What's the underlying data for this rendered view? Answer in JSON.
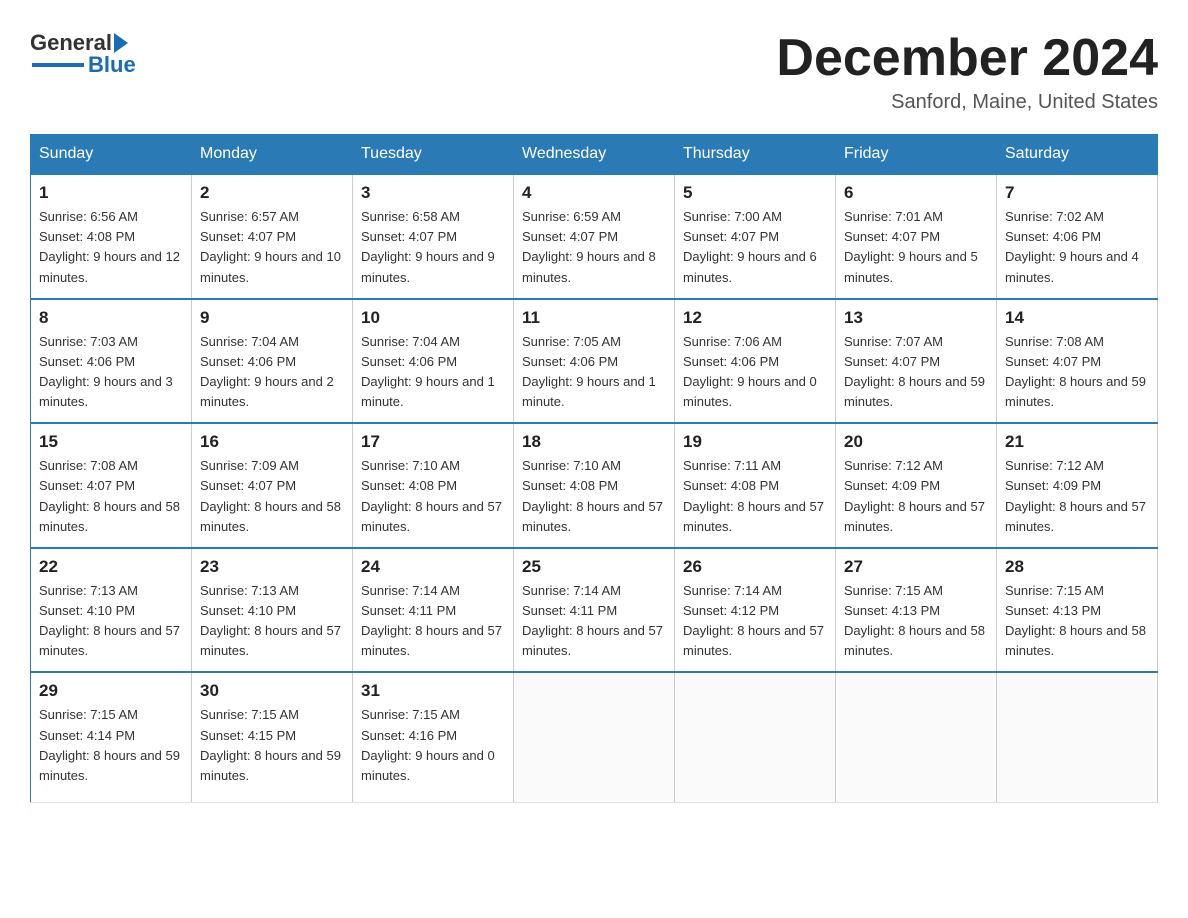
{
  "header": {
    "logo_general": "General",
    "logo_blue": "Blue",
    "month_title": "December 2024",
    "location": "Sanford, Maine, United States"
  },
  "days_of_week": [
    "Sunday",
    "Monday",
    "Tuesday",
    "Wednesday",
    "Thursday",
    "Friday",
    "Saturday"
  ],
  "weeks": [
    [
      {
        "day": 1,
        "sunrise": "Sunrise: 6:56 AM",
        "sunset": "Sunset: 4:08 PM",
        "daylight": "Daylight: 9 hours and 12 minutes."
      },
      {
        "day": 2,
        "sunrise": "Sunrise: 6:57 AM",
        "sunset": "Sunset: 4:07 PM",
        "daylight": "Daylight: 9 hours and 10 minutes."
      },
      {
        "day": 3,
        "sunrise": "Sunrise: 6:58 AM",
        "sunset": "Sunset: 4:07 PM",
        "daylight": "Daylight: 9 hours and 9 minutes."
      },
      {
        "day": 4,
        "sunrise": "Sunrise: 6:59 AM",
        "sunset": "Sunset: 4:07 PM",
        "daylight": "Daylight: 9 hours and 8 minutes."
      },
      {
        "day": 5,
        "sunrise": "Sunrise: 7:00 AM",
        "sunset": "Sunset: 4:07 PM",
        "daylight": "Daylight: 9 hours and 6 minutes."
      },
      {
        "day": 6,
        "sunrise": "Sunrise: 7:01 AM",
        "sunset": "Sunset: 4:07 PM",
        "daylight": "Daylight: 9 hours and 5 minutes."
      },
      {
        "day": 7,
        "sunrise": "Sunrise: 7:02 AM",
        "sunset": "Sunset: 4:06 PM",
        "daylight": "Daylight: 9 hours and 4 minutes."
      }
    ],
    [
      {
        "day": 8,
        "sunrise": "Sunrise: 7:03 AM",
        "sunset": "Sunset: 4:06 PM",
        "daylight": "Daylight: 9 hours and 3 minutes."
      },
      {
        "day": 9,
        "sunrise": "Sunrise: 7:04 AM",
        "sunset": "Sunset: 4:06 PM",
        "daylight": "Daylight: 9 hours and 2 minutes."
      },
      {
        "day": 10,
        "sunrise": "Sunrise: 7:04 AM",
        "sunset": "Sunset: 4:06 PM",
        "daylight": "Daylight: 9 hours and 1 minute."
      },
      {
        "day": 11,
        "sunrise": "Sunrise: 7:05 AM",
        "sunset": "Sunset: 4:06 PM",
        "daylight": "Daylight: 9 hours and 1 minute."
      },
      {
        "day": 12,
        "sunrise": "Sunrise: 7:06 AM",
        "sunset": "Sunset: 4:06 PM",
        "daylight": "Daylight: 9 hours and 0 minutes."
      },
      {
        "day": 13,
        "sunrise": "Sunrise: 7:07 AM",
        "sunset": "Sunset: 4:07 PM",
        "daylight": "Daylight: 8 hours and 59 minutes."
      },
      {
        "day": 14,
        "sunrise": "Sunrise: 7:08 AM",
        "sunset": "Sunset: 4:07 PM",
        "daylight": "Daylight: 8 hours and 59 minutes."
      }
    ],
    [
      {
        "day": 15,
        "sunrise": "Sunrise: 7:08 AM",
        "sunset": "Sunset: 4:07 PM",
        "daylight": "Daylight: 8 hours and 58 minutes."
      },
      {
        "day": 16,
        "sunrise": "Sunrise: 7:09 AM",
        "sunset": "Sunset: 4:07 PM",
        "daylight": "Daylight: 8 hours and 58 minutes."
      },
      {
        "day": 17,
        "sunrise": "Sunrise: 7:10 AM",
        "sunset": "Sunset: 4:08 PM",
        "daylight": "Daylight: 8 hours and 57 minutes."
      },
      {
        "day": 18,
        "sunrise": "Sunrise: 7:10 AM",
        "sunset": "Sunset: 4:08 PM",
        "daylight": "Daylight: 8 hours and 57 minutes."
      },
      {
        "day": 19,
        "sunrise": "Sunrise: 7:11 AM",
        "sunset": "Sunset: 4:08 PM",
        "daylight": "Daylight: 8 hours and 57 minutes."
      },
      {
        "day": 20,
        "sunrise": "Sunrise: 7:12 AM",
        "sunset": "Sunset: 4:09 PM",
        "daylight": "Daylight: 8 hours and 57 minutes."
      },
      {
        "day": 21,
        "sunrise": "Sunrise: 7:12 AM",
        "sunset": "Sunset: 4:09 PM",
        "daylight": "Daylight: 8 hours and 57 minutes."
      }
    ],
    [
      {
        "day": 22,
        "sunrise": "Sunrise: 7:13 AM",
        "sunset": "Sunset: 4:10 PM",
        "daylight": "Daylight: 8 hours and 57 minutes."
      },
      {
        "day": 23,
        "sunrise": "Sunrise: 7:13 AM",
        "sunset": "Sunset: 4:10 PM",
        "daylight": "Daylight: 8 hours and 57 minutes."
      },
      {
        "day": 24,
        "sunrise": "Sunrise: 7:14 AM",
        "sunset": "Sunset: 4:11 PM",
        "daylight": "Daylight: 8 hours and 57 minutes."
      },
      {
        "day": 25,
        "sunrise": "Sunrise: 7:14 AM",
        "sunset": "Sunset: 4:11 PM",
        "daylight": "Daylight: 8 hours and 57 minutes."
      },
      {
        "day": 26,
        "sunrise": "Sunrise: 7:14 AM",
        "sunset": "Sunset: 4:12 PM",
        "daylight": "Daylight: 8 hours and 57 minutes."
      },
      {
        "day": 27,
        "sunrise": "Sunrise: 7:15 AM",
        "sunset": "Sunset: 4:13 PM",
        "daylight": "Daylight: 8 hours and 58 minutes."
      },
      {
        "day": 28,
        "sunrise": "Sunrise: 7:15 AM",
        "sunset": "Sunset: 4:13 PM",
        "daylight": "Daylight: 8 hours and 58 minutes."
      }
    ],
    [
      {
        "day": 29,
        "sunrise": "Sunrise: 7:15 AM",
        "sunset": "Sunset: 4:14 PM",
        "daylight": "Daylight: 8 hours and 59 minutes."
      },
      {
        "day": 30,
        "sunrise": "Sunrise: 7:15 AM",
        "sunset": "Sunset: 4:15 PM",
        "daylight": "Daylight: 8 hours and 59 minutes."
      },
      {
        "day": 31,
        "sunrise": "Sunrise: 7:15 AM",
        "sunset": "Sunset: 4:16 PM",
        "daylight": "Daylight: 9 hours and 0 minutes."
      },
      null,
      null,
      null,
      null
    ]
  ]
}
